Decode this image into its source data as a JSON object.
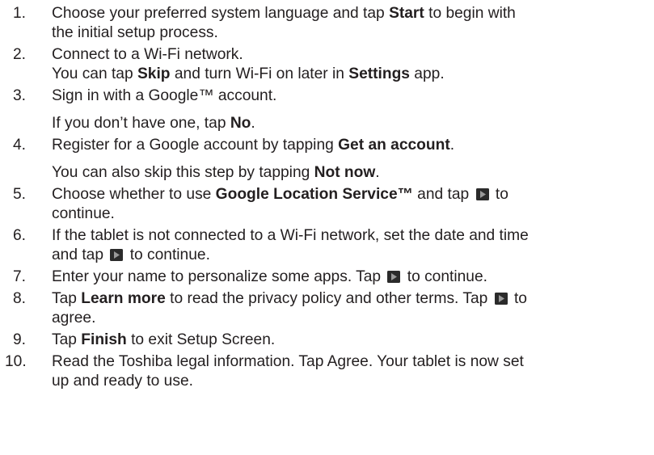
{
  "steps": [
    {
      "number": "1.",
      "lines": [
        [
          {
            "t": "Choose your preferred system language and tap "
          },
          {
            "b": "Start"
          },
          {
            "t": " to begin with"
          }
        ],
        [
          {
            "t": "the initial setup process."
          }
        ]
      ]
    },
    {
      "number": "2.",
      "lines": [
        [
          {
            "t": "Connect to a Wi-Fi network."
          }
        ],
        [
          {
            "t": "You can tap "
          },
          {
            "b": "Skip"
          },
          {
            "t": " and turn Wi-Fi on later in "
          },
          {
            "b": "Settings"
          },
          {
            "t": " app."
          }
        ]
      ]
    },
    {
      "number": "3.",
      "lines": [
        [
          {
            "t": "Sign in with a Google™ account."
          }
        ],
        [
          {
            "t": "If you don’t have one, tap "
          },
          {
            "b": "No"
          },
          {
            "t": "."
          }
        ]
      ],
      "gap_after_first": true
    },
    {
      "number": "4.",
      "lines": [
        [
          {
            "t": "Register for a Google account by tapping "
          },
          {
            "b": "Get an account"
          },
          {
            "t": "."
          }
        ],
        [
          {
            "t": "You can also skip this step by tapping "
          },
          {
            "b": "Not now"
          },
          {
            "t": "."
          }
        ]
      ],
      "gap_after_first": true
    },
    {
      "number": "5.",
      "lines": [
        [
          {
            "t": "Choose whether to use "
          },
          {
            "b": "Google Location Service™"
          },
          {
            "t": " and tap "
          },
          {
            "icon": "play-arrow-icon"
          },
          {
            "t": " to"
          }
        ],
        [
          {
            "t": "continue."
          }
        ]
      ]
    },
    {
      "number": "6.",
      "lines": [
        [
          {
            "t": "If the tablet is not connected to a Wi-Fi network, set the date and time"
          }
        ],
        [
          {
            "t": "and tap "
          },
          {
            "icon": "play-arrow-icon"
          },
          {
            "t": " to continue."
          }
        ]
      ]
    },
    {
      "number": "7.",
      "lines": [
        [
          {
            "t": "Enter your name to personalize some apps. Tap "
          },
          {
            "icon": "play-arrow-icon"
          },
          {
            "t": " to continue."
          }
        ]
      ]
    },
    {
      "number": "8.",
      "lines": [
        [
          {
            "t": "Tap "
          },
          {
            "b": "Learn more"
          },
          {
            "t": " to read the privacy policy and other terms. Tap "
          },
          {
            "icon": "play-arrow-icon"
          },
          {
            "t": " to"
          }
        ],
        [
          {
            "t": "agree."
          }
        ]
      ]
    },
    {
      "number": "9.",
      "lines": [
        [
          {
            "t": "Tap "
          },
          {
            "b": "Finish"
          },
          {
            "t": " to exit Setup Screen."
          }
        ]
      ]
    },
    {
      "number": "10.",
      "lines": [
        [
          {
            "t": "Read the Toshiba legal information. Tap Agree. Your tablet is now set"
          }
        ],
        [
          {
            "t": "up and ready to use."
          }
        ]
      ]
    }
  ],
  "icons": {
    "play-arrow-icon": {
      "box_color": "#2b2b2b",
      "arrow_color": "#9a9a9a"
    }
  }
}
